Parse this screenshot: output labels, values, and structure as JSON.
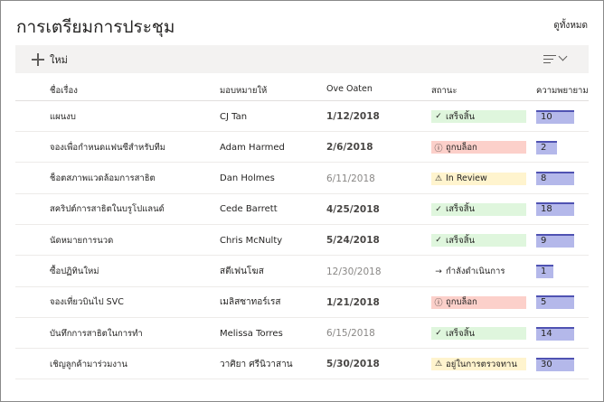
{
  "page": {
    "title": "การเตรียมการประชุม",
    "see_all": "ดูทั้งหมด"
  },
  "toolbar": {
    "new_label": "ใหม่",
    "new_icon": "plus-icon",
    "sort_icon": "lines-sort-icon",
    "dropdown_icon": "chevron-down-icon"
  },
  "columns": {
    "task": "ชื่อเรื่อง",
    "assignee": "มอบหมายให้",
    "due": "Ove Oaten",
    "status": "สถานะ",
    "effort": "ความพยายาม"
  },
  "colors": {
    "done": "#dff6dd",
    "blocked": "#fcd0ca",
    "review": "#fff4ce",
    "effort_fill": "#b4b8ea",
    "effort_line": "#4f52b2"
  },
  "rows": [
    {
      "task": "แผนงบ",
      "assignee": "CJ Tan",
      "due": "1/12/2018",
      "status": "เสร็จสิ้น",
      "status_icon": "✓",
      "kind": "done",
      "effort": "10",
      "effort_fraction": 1.0
    },
    {
      "task": "จองเพื่อกำหนดแฟนซีสำหรับทีม",
      "assignee": "Adam Harmed",
      "due": "2/6/2018",
      "status": "ถูกบล็อก",
      "status_icon": "ⓘ",
      "kind": "blocked",
      "effort": "2",
      "effort_fraction": 0.55
    },
    {
      "task": "ช็อตสภาพแวดล้อมการสาธิต",
      "assignee": "Dan Holmes",
      "due": "6/11/2018",
      "status": "In Review",
      "status_icon": "⚠",
      "kind": "review",
      "effort": "8",
      "effort_fraction": 1.0
    },
    {
      "task": "สคริปต์การสาธิตในบรูโปแลนด์",
      "assignee": "Cede Barrett",
      "due": "4/25/2018",
      "status": "เสร็จสิ้น",
      "status_icon": "✓",
      "kind": "done",
      "effort": "18",
      "effort_fraction": 1.0
    },
    {
      "task": "นัดหมายการนวด",
      "assignee": "Chris McNulty",
      "due": "5/24/2018",
      "status": "เสร็จสิ้น",
      "status_icon": "✓",
      "kind": "done",
      "effort": "9",
      "effort_fraction": 1.0
    },
    {
      "task": "ซื้อปฏิทินใหม่",
      "assignee": "สตีเฟนโฆส",
      "due": "12/30/2018",
      "status": "กำลังดำเนินการ",
      "status_icon": "→",
      "kind": "none",
      "effort": "1",
      "effort_fraction": 0.45
    },
    {
      "task": "จองเที่ยวบินไป SVC",
      "assignee": "เมลิสซาทอร์เรส",
      "due": "1/21/2018",
      "status": "ถูกบล็อก",
      "status_icon": "ⓘ",
      "kind": "blocked",
      "effort": "5",
      "effort_fraction": 1.0
    },
    {
      "task": "บันทึกการสาธิตในการทำ",
      "assignee": "Melissa Torres",
      "due": "6/15/2018",
      "status": "เสร็จสิ้น",
      "status_icon": "✓",
      "kind": "done",
      "effort": "14",
      "effort_fraction": 1.0
    },
    {
      "task": "เชิญลูกค้ามาร่วมงาน",
      "assignee": "วาศิยา ศรีนิวาสาน",
      "due": "5/30/2018",
      "status": "อยู่ในการตรวจทาน",
      "status_icon": "⚠",
      "kind": "review",
      "effort": "30",
      "effort_fraction": 1.0
    }
  ]
}
